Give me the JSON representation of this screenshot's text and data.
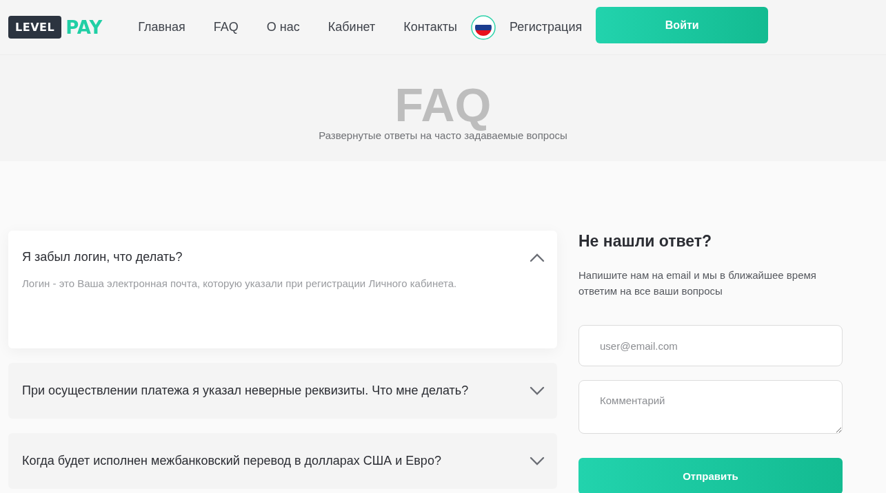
{
  "logo": {
    "left": "LEVEL",
    "right": "PAY"
  },
  "nav": [
    {
      "label": "Главная"
    },
    {
      "label": "FAQ"
    },
    {
      "label": "О нас"
    },
    {
      "label": "Кабинет"
    },
    {
      "label": "Контакты"
    }
  ],
  "register_link": "Регистрация",
  "login_button": "Войти",
  "hero": {
    "title": "FAQ",
    "subtitle": "Развернутые ответы на часто задаваемые вопросы"
  },
  "faq": [
    {
      "question": "Я забыл логин, что делать?",
      "answer": "Логин - это Ваша электронная почта, которую указали при регистрации Личного кабинета.",
      "expanded": true
    },
    {
      "question": "При осуществлении платежа я указал неверные реквизиты. Что мне делать?",
      "expanded": false
    },
    {
      "question": "Когда будет исполнен межбанковский перевод в долларах США и Евро?",
      "expanded": false
    }
  ],
  "contact": {
    "title": "Не нашли ответ?",
    "text": "Напишите нам на email и мы в ближайшее время ответим на все ваши вопросы",
    "email_placeholder": "user@email.com",
    "comment_placeholder": "Комментарий",
    "submit": "Отправить"
  }
}
